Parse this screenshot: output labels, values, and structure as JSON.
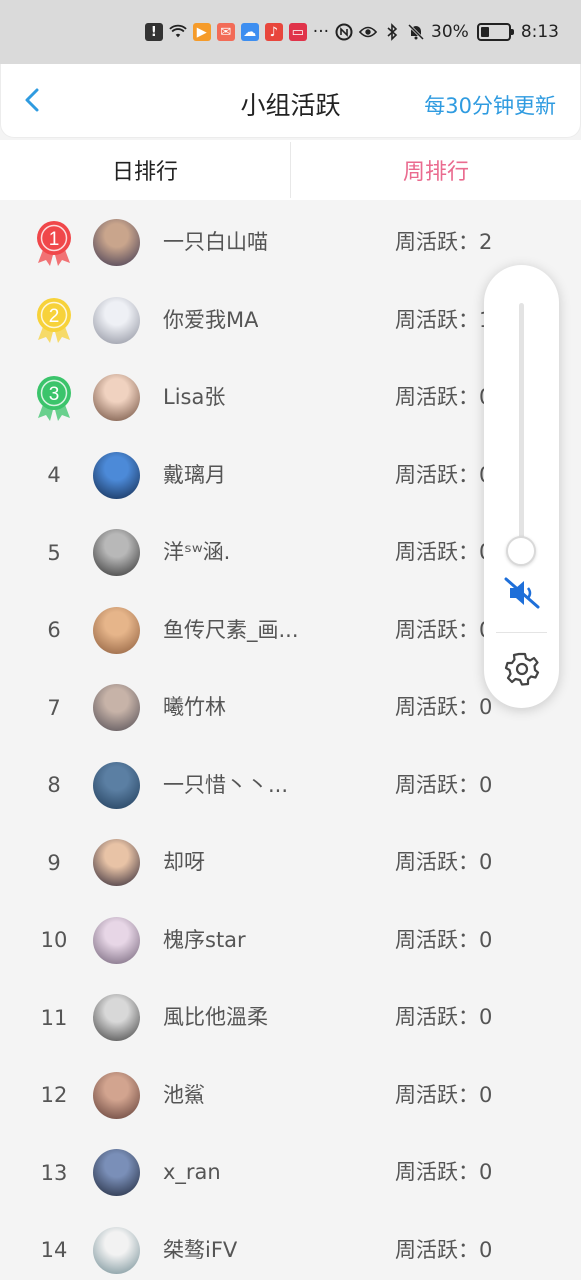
{
  "status_bar": {
    "icons": [
      "alert-icon",
      "wifi-icon",
      "app-icon-play",
      "app-icon-mail",
      "app-icon-cloud",
      "app-icon-listen",
      "app-icon-book",
      "more-dots",
      "nfc-icon",
      "eye-icon",
      "bluetooth-icon",
      "mute-bell-icon"
    ],
    "dots": "···",
    "battery_percent": "30%",
    "battery_level": 0.3,
    "time": "8:13"
  },
  "header": {
    "back_icon": "chevron-left-icon",
    "title": "小组活跃",
    "update_note": "每30分钟更新"
  },
  "tabs": [
    {
      "label": "日排行",
      "active": false
    },
    {
      "label": "周排行",
      "active": true
    }
  ],
  "colors": {
    "accent_blue": "#2f9be0",
    "active_tab_pink": "#ea6b8f",
    "medal_gold": "#f7d23a",
    "medal_red": "#f0474a",
    "medal_green": "#3bc46b"
  },
  "rankings": [
    {
      "rank": "1",
      "name": "一只白山喵",
      "score": "周活跃：2"
    },
    {
      "rank": "2",
      "name": "你爱我MA",
      "score": "周活跃：1"
    },
    {
      "rank": "3",
      "name": "Lisa张",
      "score": "周活跃：0"
    },
    {
      "rank": "4",
      "name": "戴璃月",
      "score": "周活跃：0"
    },
    {
      "rank": "5",
      "name": "洋ˢʷ涵.",
      "score": "周活跃：0"
    },
    {
      "rank": "6",
      "name": "鱼传尺素_画...",
      "score": "周活跃：0"
    },
    {
      "rank": "7",
      "name": "曦竹林",
      "score": "周活跃：0"
    },
    {
      "rank": "8",
      "name": "一只惜丶丶...",
      "score": "周活跃：0"
    },
    {
      "rank": "9",
      "name": "却呀",
      "score": "周活跃：0"
    },
    {
      "rank": "10",
      "name": "槐序star",
      "score": "周活跃：0"
    },
    {
      "rank": "11",
      "name": "風比他溫柔",
      "score": "周活跃：0"
    },
    {
      "rank": "12",
      "name": "池鯊",
      "score": "周活跃：0"
    },
    {
      "rank": "13",
      "name": "x_ran",
      "score": "周活跃：0"
    },
    {
      "rank": "14",
      "name": "桀骜iFV",
      "score": "周活跃：0"
    }
  ],
  "volume_panel": {
    "level": 0.0,
    "mute_icon": "speaker-muted-icon",
    "settings_icon": "gear-icon"
  }
}
